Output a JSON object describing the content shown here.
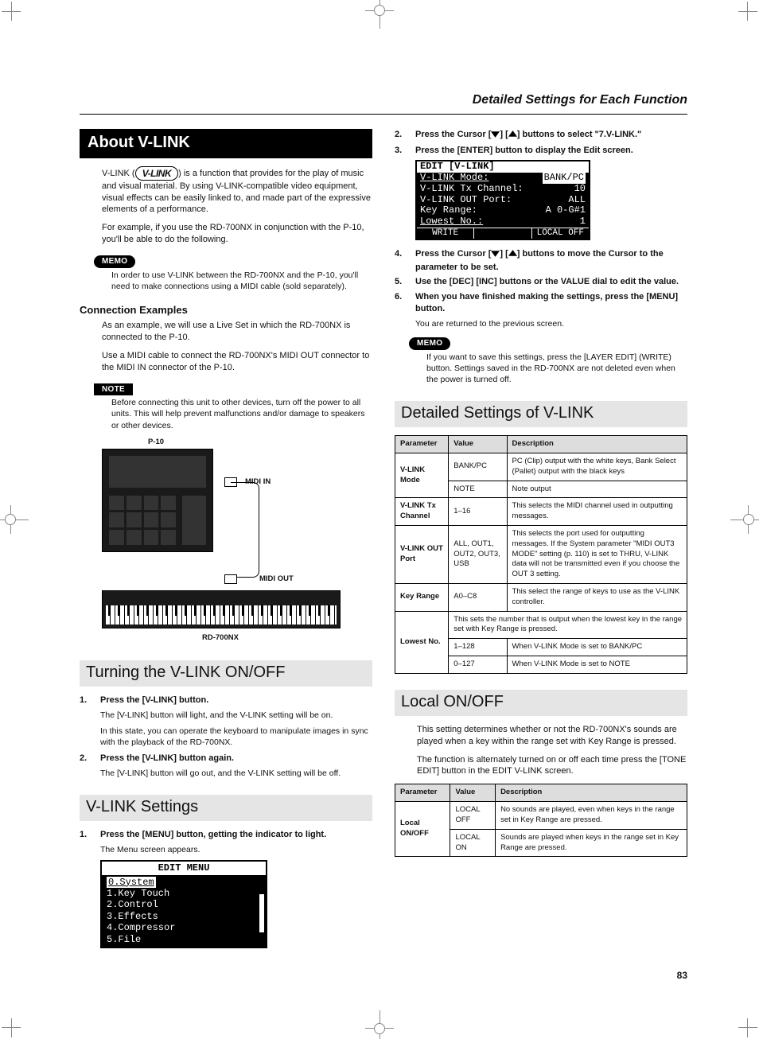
{
  "header": "Detailed Settings for Each Function",
  "page_number": "83",
  "left": {
    "h1": "About V-LINK",
    "vlink_logo_text": "V-LINK",
    "intro1_a": "V-LINK (",
    "intro1_b": ") is a function that provides for the play of music and visual material. By using V-LINK-compatible video equipment, visual effects can be easily linked to, and made part of the expressive elements of a performance.",
    "intro2": "For example, if you use the RD-700NX in conjunction with the P-10, you'll be able to do the following.",
    "memo_label": "MEMO",
    "memo1": "In order to use V-LINK between the RD-700NX and the P-10, you'll need to make connections using a MIDI cable (sold separately).",
    "h_conn": "Connection Examples",
    "conn1": "As an example, we will use a Live Set in which the RD-700NX is connected to the P-10.",
    "conn2": "Use a MIDI cable to connect the RD-700NX's MIDI OUT connector to the MIDI IN connector of the P-10.",
    "note_label": "NOTE",
    "note1": "Before connecting this unit to other devices, turn off the power to all units. This will help prevent malfunctions and/or damage to speakers or other devices.",
    "diagram": {
      "p10": "P-10",
      "midi_in": "MIDI IN",
      "midi_out": "MIDI OUT",
      "rd": "RD-700NX"
    },
    "h_turn": "Turning the V-LINK ON/OFF",
    "turn_steps": [
      {
        "n": "1.",
        "t": "Press the [V-LINK] button."
      },
      {
        "n": "2.",
        "t": "Press the [V-LINK] button again."
      }
    ],
    "turn_sub1": "The [V-LINK] button will light, and the V-LINK setting will be on.",
    "turn_sub2": "In this state, you can operate the keyboard to manipulate images in sync with the playback of the RD-700NX.",
    "turn_sub3": "The [V-LINK] button will go out, and the V-LINK setting will be off.",
    "h_settings": "V-LINK Settings",
    "set_step1_n": "1.",
    "set_step1_t": "Press the [MENU] button, getting the indicator to light.",
    "set_sub1": "The Menu screen appears.",
    "lcd1": {
      "title": "EDIT MENU",
      "lines": [
        "0.System",
        "1.Key Touch",
        "2.Control",
        "3.Effects",
        "4.Compressor",
        "5.File"
      ]
    }
  },
  "right": {
    "steps_a": [
      {
        "n": "2.",
        "pre": "Press the Cursor [",
        "mid": "] [",
        "post": "] buttons to select \"7.V-LINK.\""
      },
      {
        "n": "3.",
        "t": "Press the [ENTER] button to display the Edit screen."
      }
    ],
    "lcd2": {
      "title": "EDIT [V-LINK]",
      "rows": [
        [
          "V-LINK Mode:",
          "BANK/PC"
        ],
        [
          "V-LINK Tx Channel:",
          "10"
        ],
        [
          "V-LINK OUT Port:",
          "ALL"
        ],
        [
          "Key Range:",
          "A 0-G#1"
        ],
        [
          "Lowest No.:",
          "1"
        ]
      ],
      "foot": [
        "WRITE",
        "",
        "LOCAL OFF"
      ]
    },
    "steps_b": [
      {
        "n": "4.",
        "pre": "Press the Cursor [",
        "mid": "] [",
        "post": "] buttons to move the Cursor to the parameter to be set."
      },
      {
        "n": "5.",
        "t": "Use the [DEC] [INC] buttons or the VALUE dial to edit the value."
      },
      {
        "n": "6.",
        "t": "When you have finished making the settings, press the [MENU] button."
      }
    ],
    "steps_b_sub": "You are returned to the previous screen.",
    "memo_label": "MEMO",
    "memo2": "If you want to save this settings, press the [LAYER EDIT] (WRITE) button. Settings saved in the RD-700NX are not deleted even when the power is turned off.",
    "h_detail": "Detailed Settings of V-LINK",
    "table1": {
      "head": [
        "Parameter",
        "Value",
        "Description"
      ],
      "rows": [
        {
          "p": "V-LINK Mode",
          "v": "BANK/PC",
          "d": "PC (Clip) output with the white keys, Bank Select (Pallet) output with the black keys",
          "rs": 2
        },
        {
          "v": "NOTE",
          "d": "Note output"
        },
        {
          "p": "V-LINK Tx Channel",
          "v": "1–16",
          "d": "This selects the MIDI channel used in outputting messages."
        },
        {
          "p": "V-LINK OUT Port",
          "v": "ALL, OUT1, OUT2, OUT3, USB",
          "d": "This selects the port used for outputting messages. If the System parameter \"MIDI OUT3 MODE\" setting (p. 110) is set to THRU, V-LINK data will not be transmitted even if you choose the OUT 3 setting."
        },
        {
          "p": "Key Range",
          "v": "A0–C8",
          "d": "This select the range of keys to use as the V-LINK controller."
        },
        {
          "p": "Lowest No.",
          "span": "This sets the number that is output when the lowest key in the range set with Key Range is pressed.",
          "rs": 3
        },
        {
          "v": "1–128",
          "d": "When V-LINK Mode is set to BANK/PC"
        },
        {
          "v": "0–127",
          "d": "When V-LINK Mode is set to NOTE"
        }
      ]
    },
    "h_local": "Local ON/OFF",
    "local1": "This setting determines whether or not the RD-700NX's sounds are played when a key within the range set with Key Range is pressed.",
    "local2": "The function is alternately turned on or off each time press the [TONE EDIT] button in the EDIT V-LINK screen.",
    "table2": {
      "head": [
        "Parameter",
        "Value",
        "Description"
      ],
      "rows": [
        {
          "p": "Local ON/OFF",
          "v": "LOCAL OFF",
          "d": "No sounds are played, even when keys in the range set in Key Range are pressed.",
          "rs": 2
        },
        {
          "v": "LOCAL ON",
          "d": "Sounds are played when keys in the range set in Key Range are pressed."
        }
      ]
    }
  }
}
